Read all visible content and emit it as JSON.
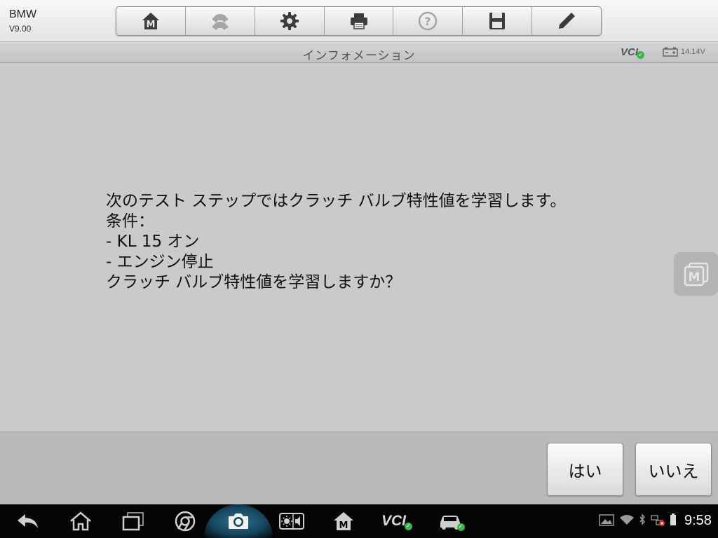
{
  "app": {
    "name": "BMW",
    "version": "V9.00"
  },
  "toolbar": {
    "buttons": [
      {
        "icon": "home-m-icon"
      },
      {
        "icon": "vehicle-swap-icon"
      },
      {
        "icon": "gear-icon"
      },
      {
        "icon": "printer-icon"
      },
      {
        "icon": "help-icon"
      },
      {
        "icon": "save-icon"
      },
      {
        "icon": "pencil-icon"
      }
    ]
  },
  "titlebar": {
    "title": "インフォメーション",
    "vci": "VCI",
    "voltage": "14.14V"
  },
  "message": {
    "lines": [
      "次のテスト ステップではクラッチ バルブ特性値を学習します。",
      "条件：",
      "- KL 15 オン",
      "- エンジン停止",
      "クラッチ バルブ特性値を学習しますか？"
    ]
  },
  "actions": {
    "yes": "はい",
    "no": "いいえ"
  },
  "navbar": {
    "vci_label": "VCI",
    "time": "9:58"
  },
  "colors": {
    "accent_green": "#3bb54a",
    "background": "#c9cacc"
  }
}
